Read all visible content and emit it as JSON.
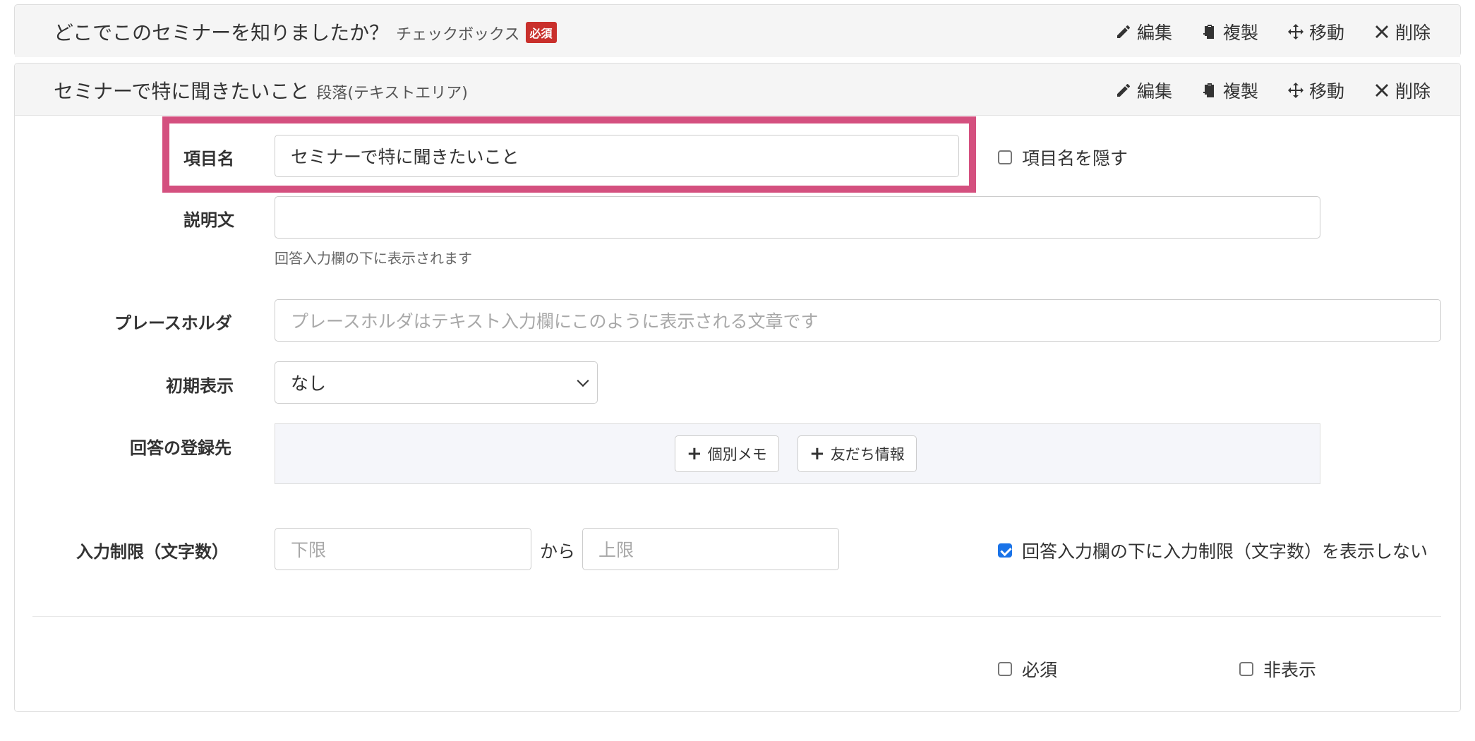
{
  "panel1": {
    "title": "どこでこのセミナーを知りましたか？",
    "type": "チェックボックス",
    "required_badge": "必須"
  },
  "panel2": {
    "title": "セミナーで特に聞きたいこと",
    "type": "段落(テキストエリア)"
  },
  "actions": {
    "edit": "編集",
    "duplicate": "複製",
    "move": "移動",
    "delete": "削除"
  },
  "form": {
    "item_name_label": "項目名",
    "item_name_value": "セミナーで特に聞きたいこと",
    "hide_item_name_label": "項目名を隠す",
    "hide_item_name_checked": false,
    "description_label": "説明文",
    "description_value": "",
    "description_help": "回答入力欄の下に表示されます",
    "placeholder_label": "プレースホルダ",
    "placeholder_hint": "プレースホルダはテキスト入力欄にこのように表示される文章です",
    "initial_display_label": "初期表示",
    "initial_display_value": "なし",
    "registration_label": "回答の登録先",
    "registration_buttons": [
      "個別メモ",
      "友だち情報"
    ],
    "limit_label": "入力制限（文字数）",
    "limit_min_placeholder": "下限",
    "limit_connector": "から",
    "limit_max_placeholder": "上限",
    "hide_limit_label": "回答入力欄の下に入力制限（文字数）を表示しない",
    "hide_limit_checked": true,
    "required_label": "必須",
    "required_checked": false,
    "hidden_label": "非表示",
    "hidden_checked": false
  },
  "colors": {
    "highlight": "#d4507f",
    "badge": "#c9302c",
    "checkbox_checked": "#1a73e8"
  },
  "icons": {
    "edit": "pencil-icon",
    "duplicate": "clipboard-icon",
    "move": "move-arrows-icon",
    "delete": "close-icon",
    "add": "plus-icon"
  }
}
